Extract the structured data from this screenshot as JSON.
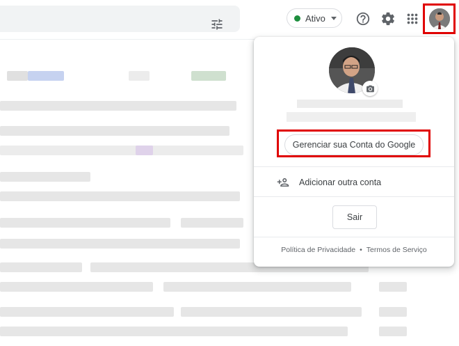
{
  "header": {
    "status_label": "Ativo",
    "status_color": "#1e8e3e",
    "icons": [
      "tune-icon",
      "help-icon",
      "settings-gear-icon",
      "apps-grid-icon"
    ]
  },
  "account_panel": {
    "manage_label": "Gerenciar sua Conta do Google",
    "add_account_label": "Adicionar outra conta",
    "signout_label": "Sair",
    "privacy_label": "Política de Privacidade",
    "separator": "•",
    "terms_label": "Termos de Serviço"
  },
  "highlight_color": "#e00000"
}
